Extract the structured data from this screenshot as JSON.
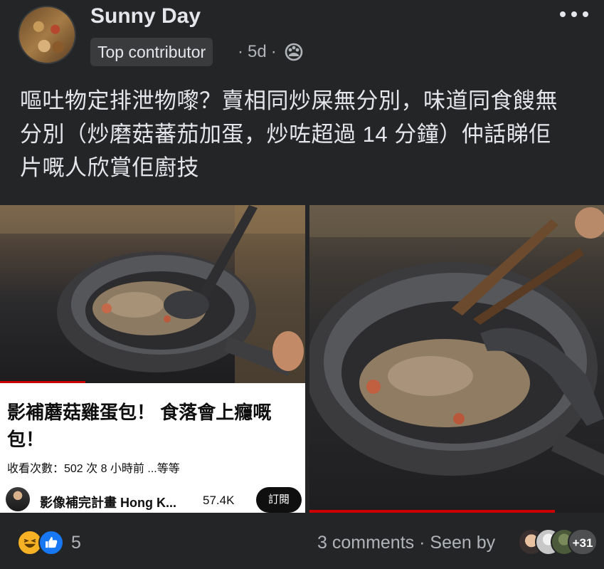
{
  "post": {
    "author": "Sunny Day",
    "badge": "Top contributor",
    "time": "5d",
    "text_line1": "嘔吐物定排泄物嚟？賣相同炒屎無分別，味道同食餿無",
    "text_line2": "分別（炒磨菇蕃茄加蛋，炒咗超過 14 分鐘）仲話睇佢",
    "text_line3": "片嘅人欣賞佢廚技"
  },
  "video_card": {
    "title": "影補蘑菇雞蛋包！ 食落會上癮嘅包！",
    "stats": "收看次數：502 次  8 小時前  ...等等",
    "channel": "影像補完計畫 Hong K...",
    "subscribers": "57.4K",
    "subscribe_label": "訂閱"
  },
  "footer": {
    "reaction_count": "5",
    "comments": "3 comments",
    "seen_by": "Seen by",
    "seen_more": "+31"
  },
  "colors": {
    "background": "#242526",
    "text_primary": "#e4e6eb",
    "text_secondary": "#b0b3b8",
    "like_blue": "#1877f2",
    "haha_yellow": "#f7b125",
    "youtube_red": "#cc0000"
  },
  "icons": [
    "more-options-icon",
    "friends-privacy-icon",
    "haha-reaction-icon",
    "like-reaction-icon"
  ]
}
